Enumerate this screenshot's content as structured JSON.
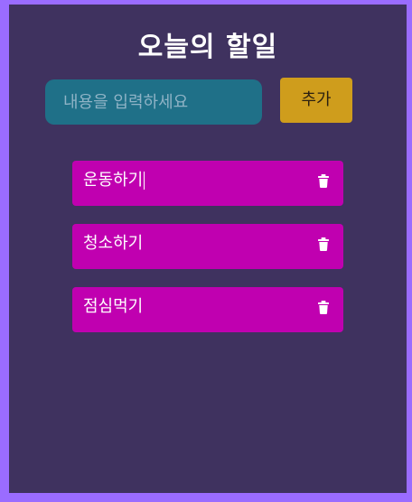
{
  "app": {
    "title": "오늘의 할일"
  },
  "input": {
    "placeholder": "내용을 입력하세요",
    "value": ""
  },
  "add_button": {
    "label": "추가"
  },
  "todos": [
    {
      "text": "운동하기",
      "icon": "trash-icon",
      "editing": true
    },
    {
      "text": "청소하기",
      "icon": "trash-icon",
      "editing": false
    },
    {
      "text": "점심먹기",
      "icon": "trash-icon",
      "editing": false
    }
  ],
  "colors": {
    "page_border": "#9a6cff",
    "app_background": "#3f325f",
    "input_background": "#1f7088",
    "add_button": "#cf9d1c",
    "todo_item": "#c000b0"
  }
}
